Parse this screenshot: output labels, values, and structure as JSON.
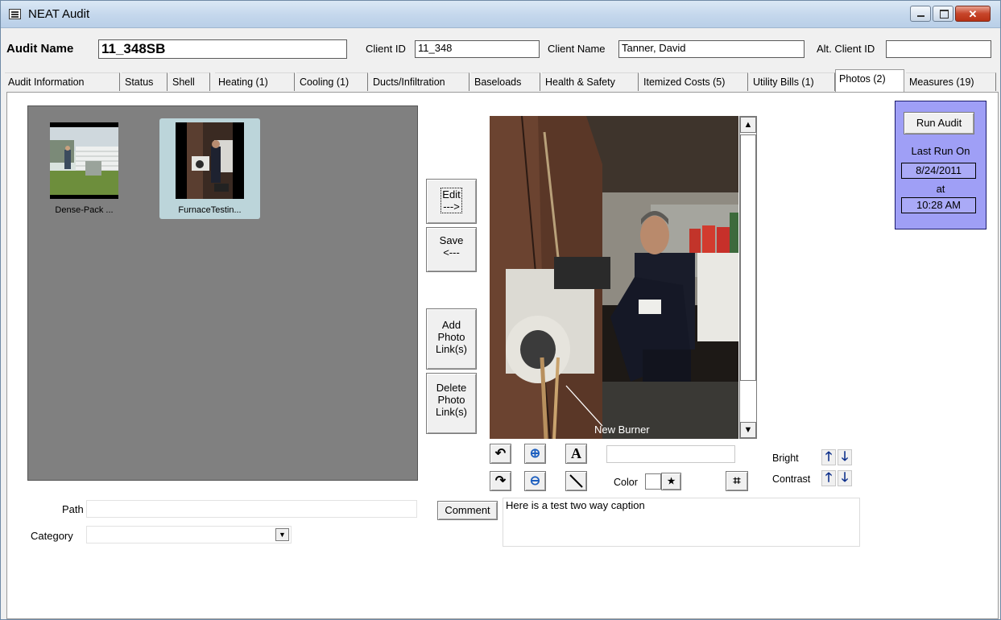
{
  "window": {
    "title": "NEAT Audit"
  },
  "header": {
    "audit_name_label": "Audit Name",
    "audit_name": "11_348SB",
    "client_id_label": "Client ID",
    "client_id": "11_348",
    "client_name_label": "Client Name",
    "client_name": "Tanner, David",
    "alt_client_id_label": "Alt. Client ID",
    "alt_client_id": ""
  },
  "tabs": [
    {
      "label": "Audit Information"
    },
    {
      "label": "Status"
    },
    {
      "label": "Shell"
    },
    {
      "label": "Heating (1)"
    },
    {
      "label": "Cooling (1)"
    },
    {
      "label": "Ducts/Infiltration"
    },
    {
      "label": "Baseloads"
    },
    {
      "label": "Health & Safety"
    },
    {
      "label": "Itemized Costs (5)"
    },
    {
      "label": "Utility Bills (1)"
    },
    {
      "label": "Photos (2)",
      "active": true
    },
    {
      "label": "Measures (19)"
    }
  ],
  "photos": {
    "thumbnails": [
      {
        "caption": "Dense-Pack ..."
      },
      {
        "caption": "FurnaceTestin...",
        "selected": true
      }
    ],
    "image_caption": "New Burner",
    "edit_label_1": "Edit",
    "edit_label_2": "--->",
    "save_label_1": "Save",
    "save_label_2": "<---",
    "add_label_1": "Add",
    "add_label_2": "Photo",
    "add_label_3": "Link(s)",
    "delete_label_1": "Delete",
    "delete_label_2": "Photo",
    "delete_label_3": "Link(s)",
    "color_label": "Color",
    "bright_label": "Bright",
    "contrast_label": "Contrast",
    "text_input": "",
    "path_label": "Path",
    "path_value": "",
    "category_label": "Category",
    "category_value": "",
    "comment_button": "Comment",
    "comment_text": "Here is a test two way caption"
  },
  "run": {
    "button": "Run Audit",
    "last_run_label": "Last Run On",
    "date": "8/24/2011",
    "at_label": "at",
    "time": "10:28 AM"
  },
  "colors": {
    "run_box": "#9f9ff6",
    "thumb_area": "#808080",
    "selected_thumb": "#bcd5da"
  }
}
